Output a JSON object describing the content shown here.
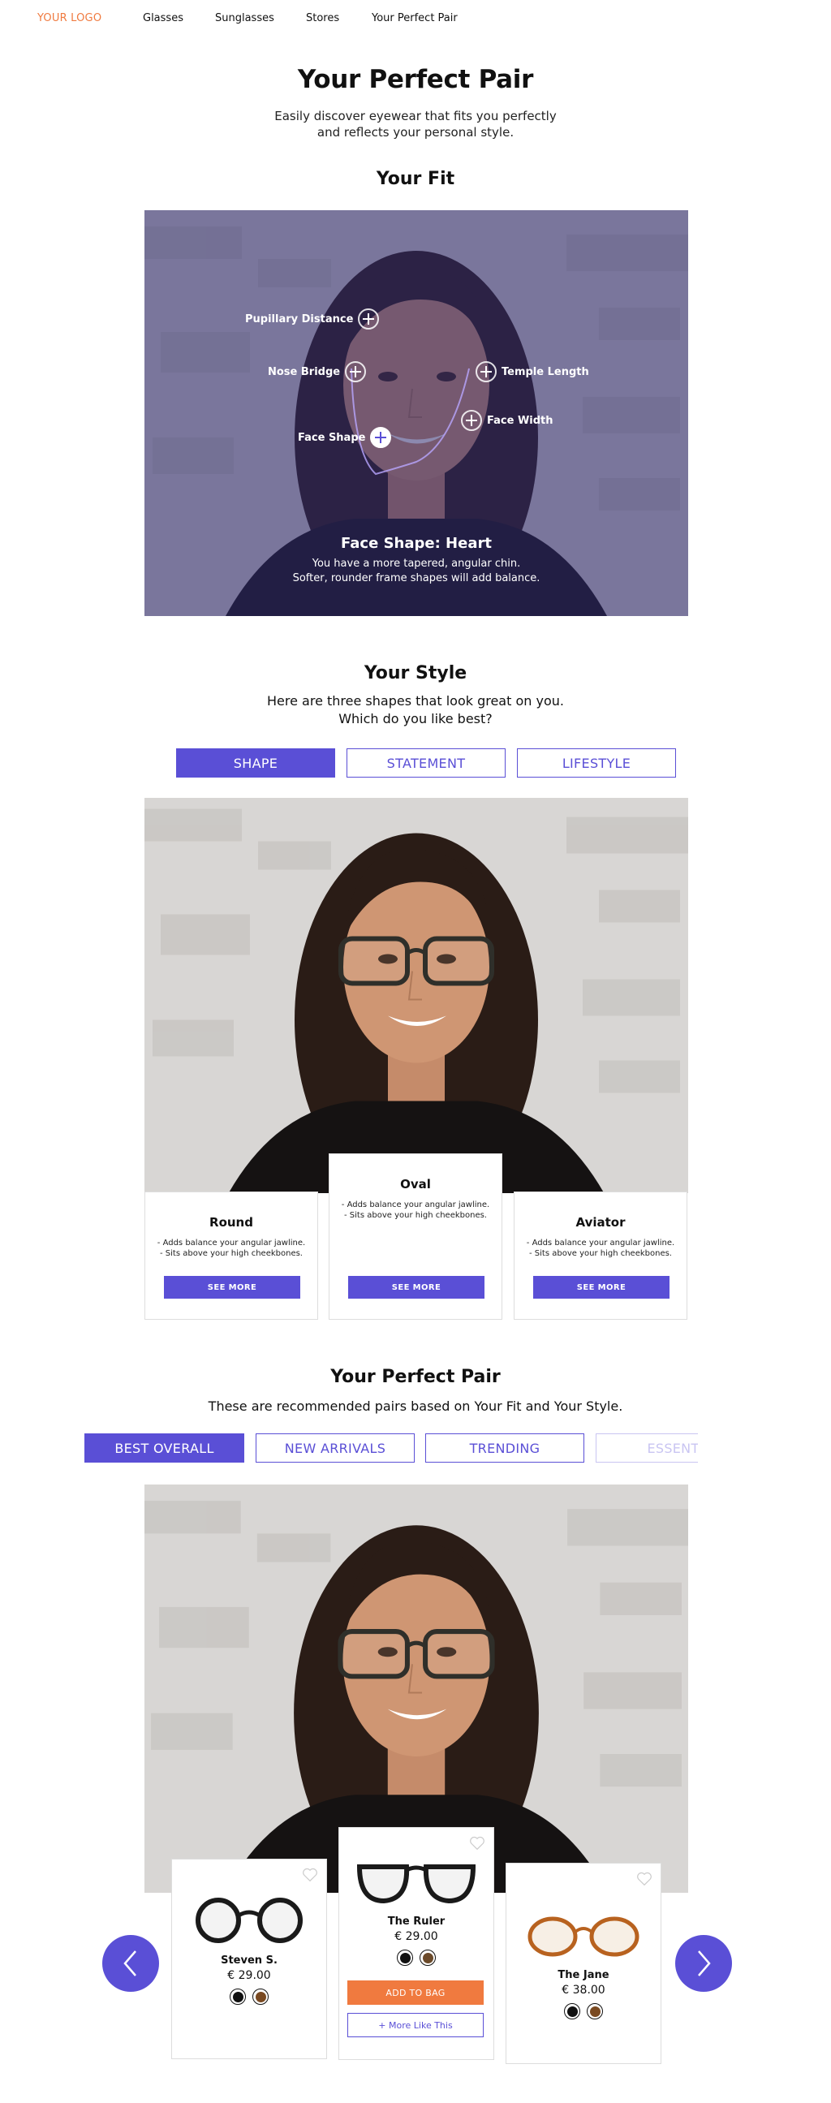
{
  "nav": {
    "logo": "YOUR LOGO",
    "links": [
      "Glasses",
      "Sunglasses",
      "Stores",
      "Your Perfect Pair"
    ]
  },
  "hero": {
    "title": "Your Perfect Pair",
    "subtitle_line1": "Easily discover eyewear that fits you perfectly",
    "subtitle_line2": "and reflects your personal style."
  },
  "fit": {
    "title": "Your Fit",
    "markers": {
      "pupillary": "Pupillary Distance",
      "nose": "Nose Bridge",
      "temple": "Temple Length",
      "width": "Face Width",
      "shape": "Face Shape"
    },
    "result_title": "Face Shape: Heart",
    "result_line1": "You have a more tapered, angular chin.",
    "result_line2": "Softer, rounder frame shapes will add balance."
  },
  "style": {
    "title": "Your Style",
    "subtitle_line1": "Here are three shapes that look great on you.",
    "subtitle_line2": "Which do you like best?",
    "tabs": [
      "SHAPE",
      "STATEMENT",
      "LIFESTYLE"
    ],
    "active_tab": "SHAPE",
    "cards": [
      {
        "name": "Round",
        "bullet1": "- Adds balance your angular jawline.",
        "bullet2": "- Sits above your high cheekbones.",
        "button": "SEE MORE"
      },
      {
        "name": "Oval",
        "bullet1": "- Adds balance your angular jawline.",
        "bullet2": "- Sits above your high cheekbones.",
        "button": "SEE MORE"
      },
      {
        "name": "Aviator",
        "bullet1": "- Adds balance your angular jawline.",
        "bullet2": "- Sits above your high cheekbones.",
        "button": "SEE MORE"
      }
    ]
  },
  "pair": {
    "title": "Your Perfect Pair",
    "subtitle": "These are recommended pairs based on Your Fit and Your Style.",
    "tabs": [
      "BEST OVERALL",
      "NEW ARRIVALS",
      "TRENDING",
      "ESSENTI"
    ],
    "active_tab": "BEST OVERALL",
    "products": [
      {
        "name": "Steven S.",
        "price": "€ 29.00",
        "colors": [
          "#111111",
          "#7a4a22"
        ]
      },
      {
        "name": "The Ruler",
        "price": "€ 29.00",
        "colors": [
          "#111111",
          "#6b4a2a"
        ],
        "add_label": "ADD TO BAG",
        "more_label": "+ More Like This"
      },
      {
        "name": "The Jane",
        "price": "€ 38.00",
        "colors": [
          "#111111",
          "#7a4a22"
        ]
      }
    ]
  },
  "colors": {
    "accent": "#5a4fd6",
    "brand": "#f07a3f"
  },
  "icons": {
    "prev": "chevron-left-icon",
    "next": "chevron-right-icon",
    "favorite": "heart-icon",
    "marker": "plus-icon"
  }
}
